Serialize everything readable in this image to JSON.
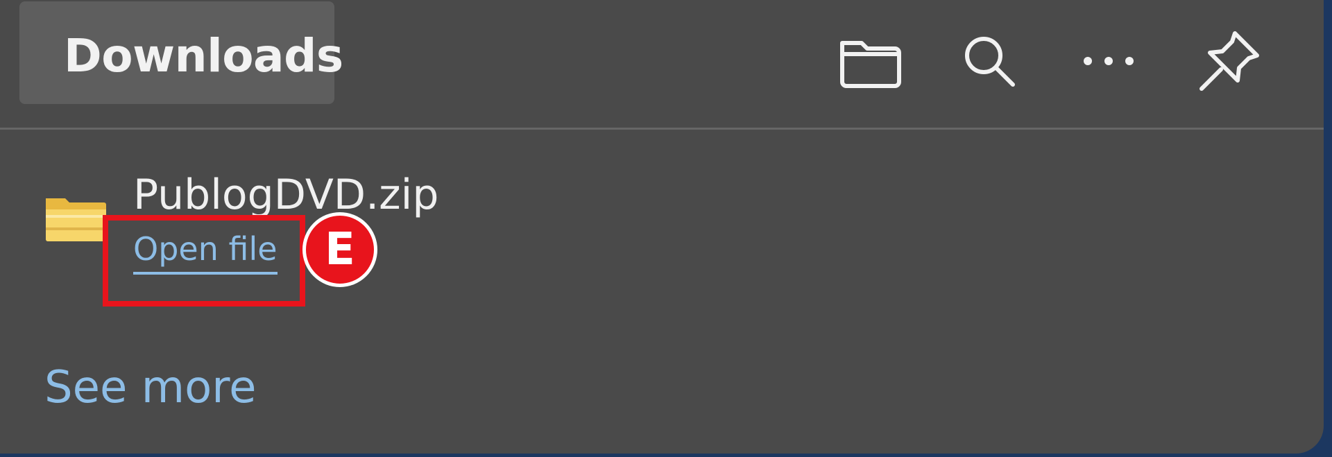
{
  "panel": {
    "title": "Downloads",
    "toolbar": [
      {
        "name": "folder-icon",
        "label": "Open downloads folder"
      },
      {
        "name": "search-icon",
        "label": "Search downloads"
      },
      {
        "name": "more-options-icon",
        "label": "More options"
      },
      {
        "name": "pin-icon",
        "label": "Pin downloads"
      }
    ]
  },
  "download_item": {
    "filename": "PublogDVD.zip",
    "action_label": "Open file",
    "icon": "folder-zip-icon"
  },
  "annotation": {
    "marker_label": "E",
    "color": "#e8141c"
  },
  "footer": {
    "see_more_label": "See more"
  },
  "colors": {
    "panel_bg": "#4a4a4a",
    "title_pill_bg": "#5e5e5e",
    "link": "#8dbde6",
    "text": "#f0f0f0",
    "backdrop": "#1c3760"
  }
}
